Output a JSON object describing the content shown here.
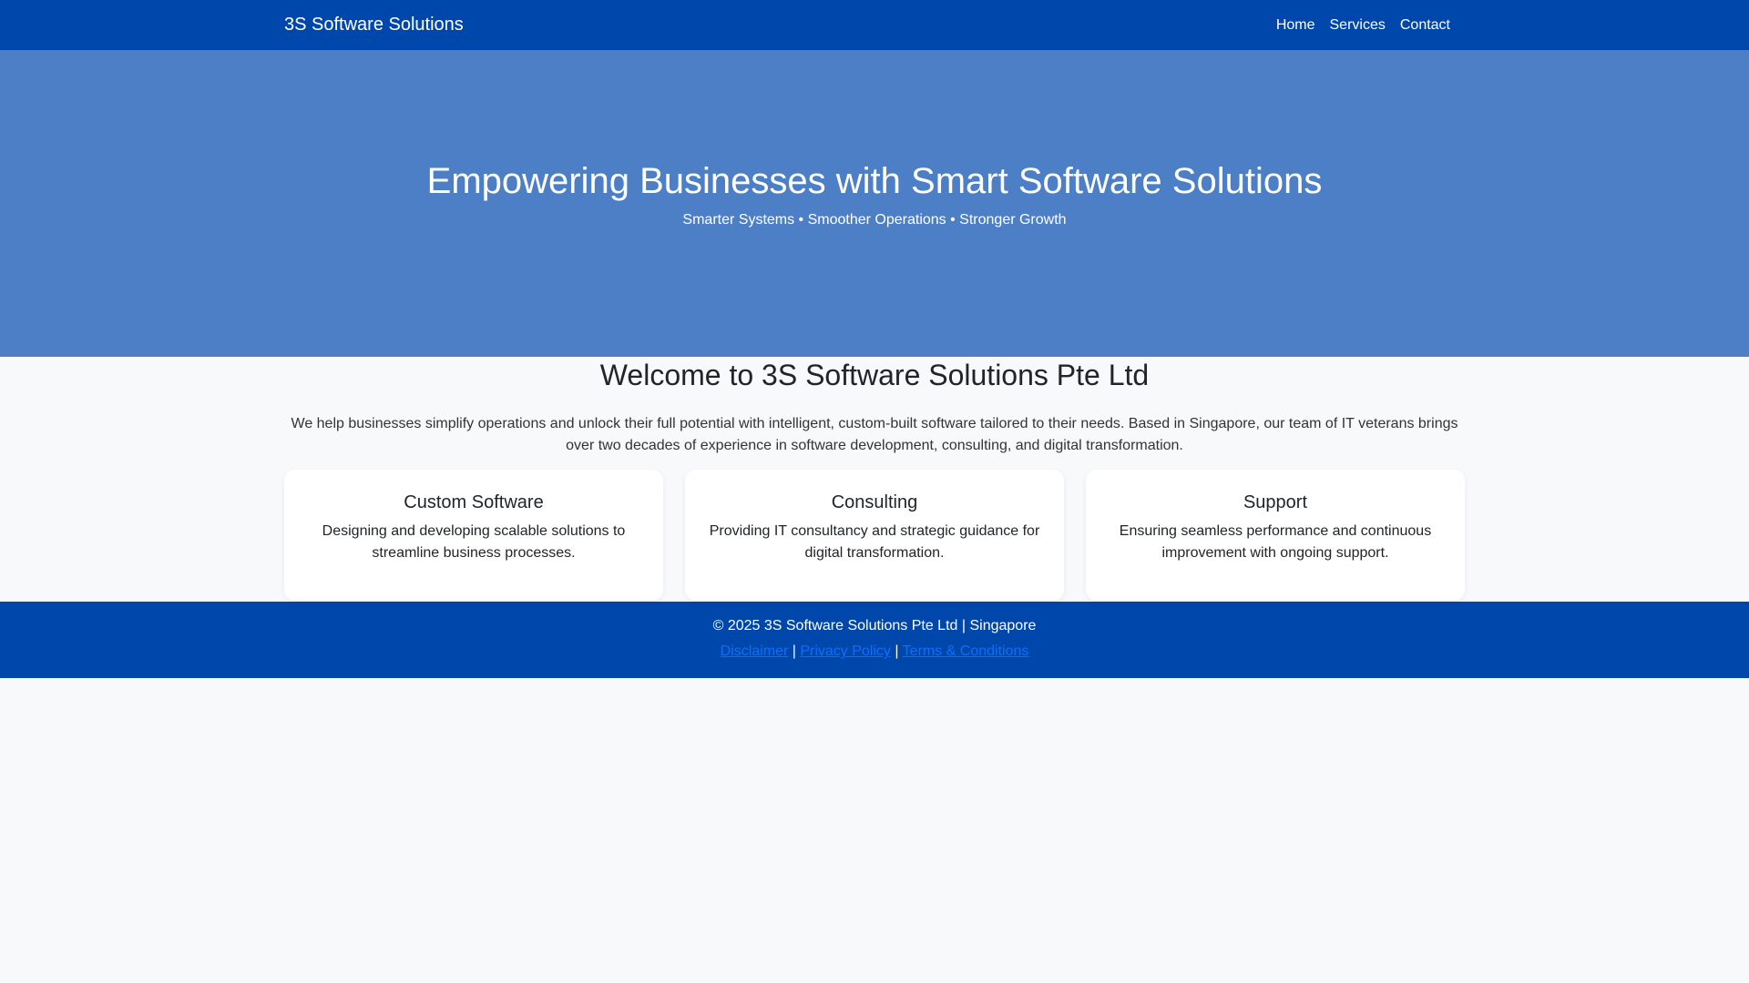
{
  "colors": {
    "navbar_bg": "#0047ab",
    "hero_bg": "#4c7fc5",
    "page_bg": "#f8f9fa",
    "link": "#0d6efd"
  },
  "navbar": {
    "brand": "3S Software Solutions",
    "links": [
      "Home",
      "Services",
      "Contact"
    ]
  },
  "hero": {
    "title": "Empowering Businesses with Smart Software Solutions",
    "subtitle": "Smarter Systems • Smoother Operations • Stronger Growth"
  },
  "welcome": {
    "title": "Welcome to 3S Software Solutions Pte Ltd",
    "text": "We help businesses simplify operations and unlock their full potential with intelligent, custom-built software tailored to their needs. Based in Singapore, our team of IT veterans brings over two decades of experience in software development, consulting, and digital transformation."
  },
  "services": [
    {
      "title": "Custom Software",
      "text": "Designing and developing scalable solutions to streamline business processes."
    },
    {
      "title": "Consulting",
      "text": "Providing IT consultancy and strategic guidance for digital transformation."
    },
    {
      "title": "Support",
      "text": "Ensuring seamless performance and continuous improvement with ongoing support."
    }
  ],
  "footer": {
    "copyright": "© 2025 3S Software Solutions Pte Ltd | Singapore",
    "links": [
      "Disclaimer",
      "Privacy Policy",
      "Terms & Conditions"
    ],
    "separator": "|"
  }
}
